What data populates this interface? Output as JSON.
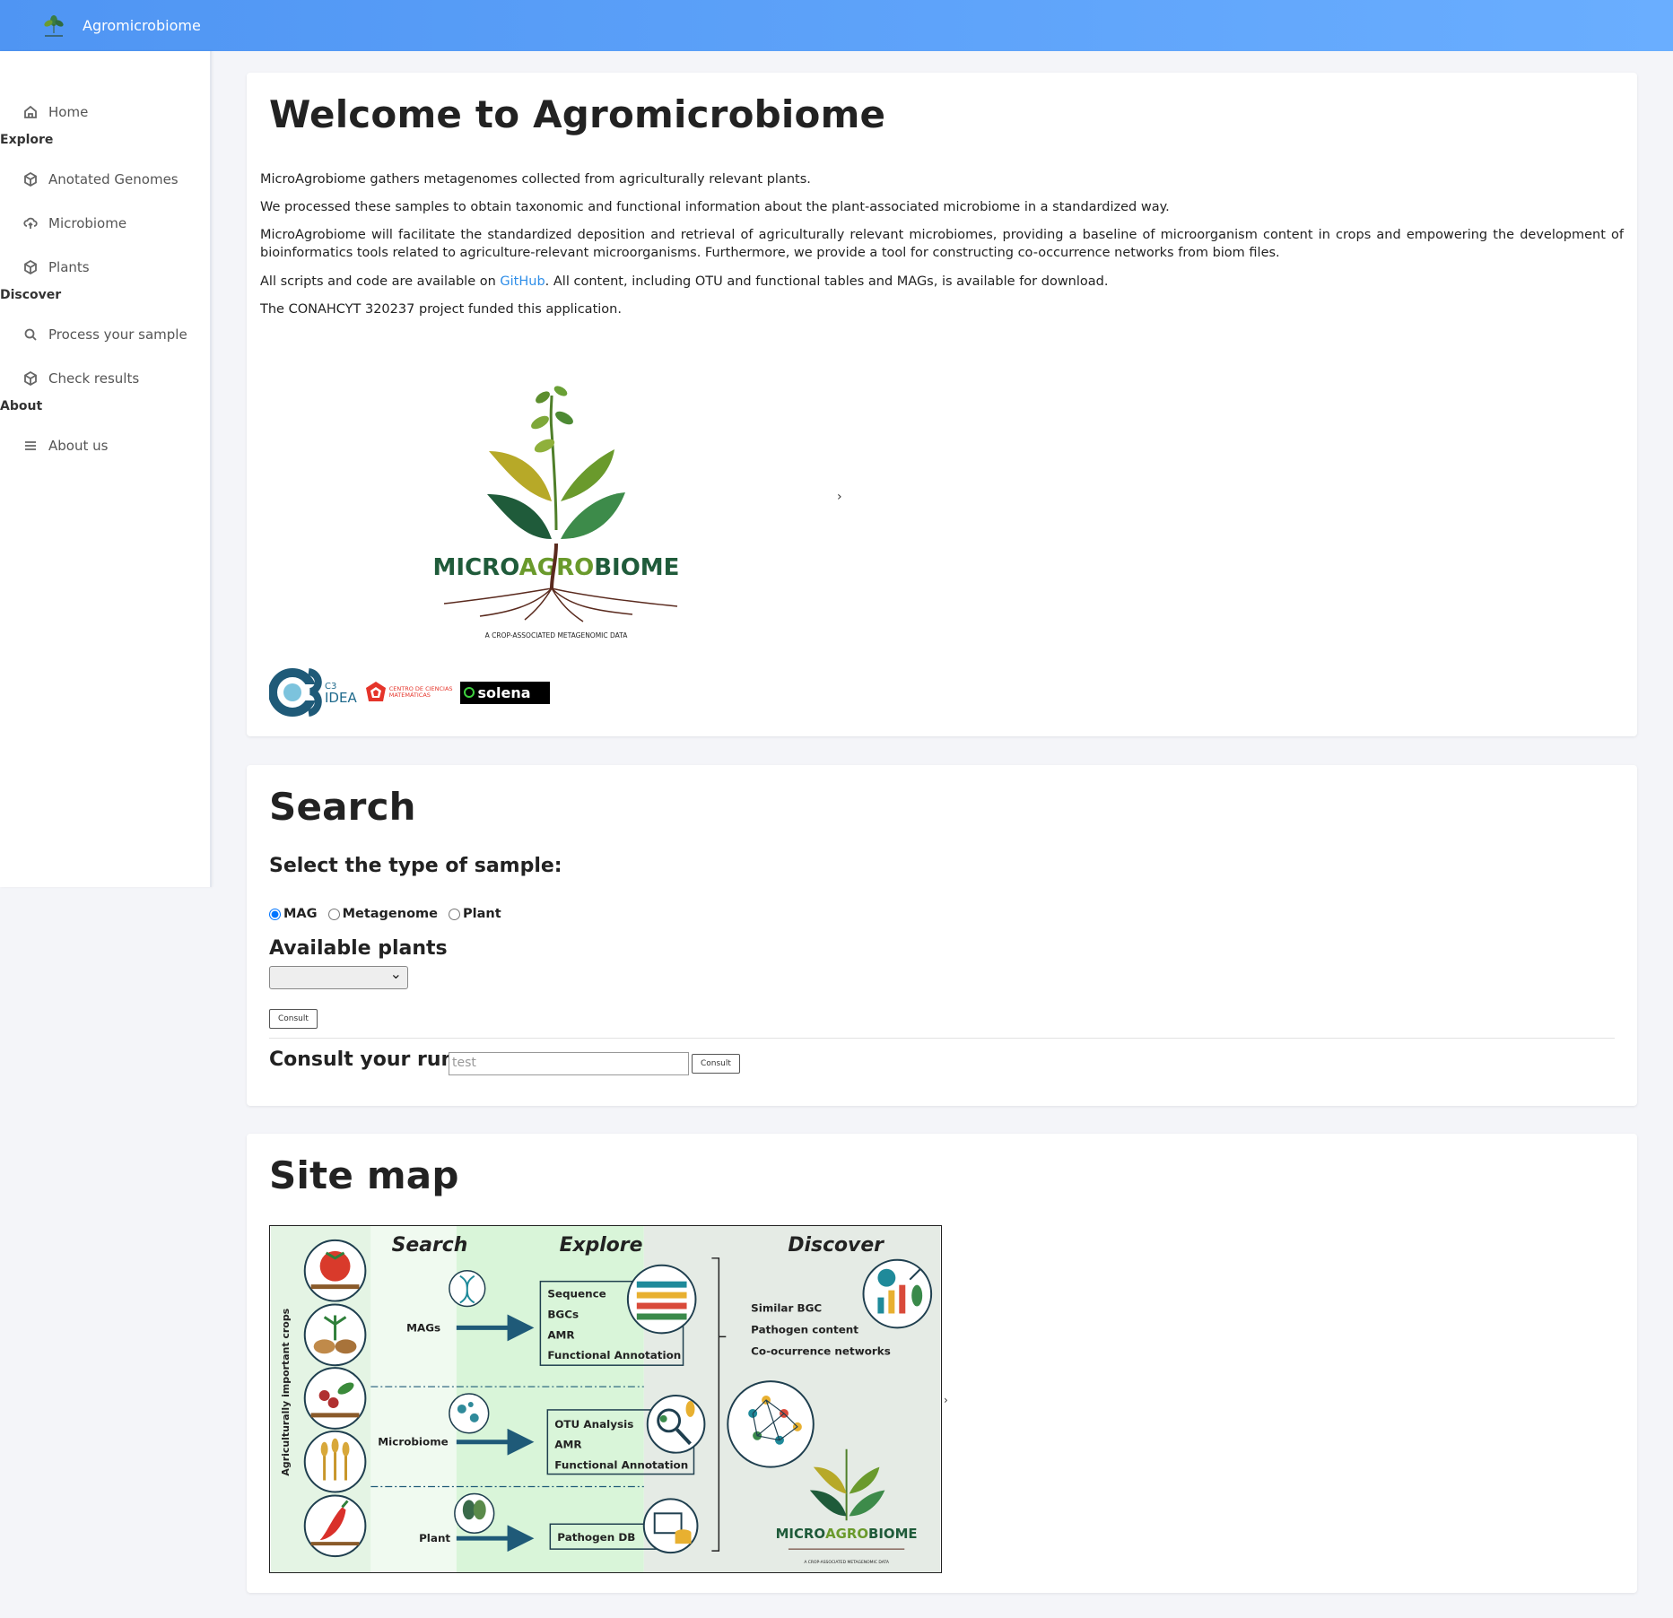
{
  "app": {
    "name": "Agromicrobiome"
  },
  "sidebar": {
    "home": "Home",
    "sections": {
      "explore": "Explore",
      "discover": "Discover",
      "about": "About"
    },
    "explore_items": [
      "Anotated Genomes",
      "Microbiome",
      "Plants"
    ],
    "discover_items": [
      "Process your sample",
      "Check results"
    ],
    "about_items": [
      "About us"
    ]
  },
  "welcome": {
    "title": "Welcome to Agromicrobiome",
    "p1": "MicroAgrobiome gathers metagenomes collected from agriculturally relevant plants.",
    "p2": "We processed these samples to obtain taxonomic and functional information about the plant-associated microbiome in a standardized way.",
    "p3": "MicroAgrobiome will facilitate the standardized deposition and retrieval of agriculturally relevant microbiomes, providing a baseline of microorganism content in crops and empowering the development of bioinformatics tools related to agriculture-relevant microorganisms. Furthermore, we provide a tool for constructing co-occurrence networks from biom files.",
    "p4_before": "All scripts and code are available on ",
    "p4_link": "GitHub",
    "p4_after": ". All content, including OTU and functional tables and MAGs, is available for download.",
    "p5": "The CONAHCYT 320237 project funded this application.",
    "logo_text_micro": "MICRO",
    "logo_text_agro": "AGRO",
    "logo_text_biome": "BIOME",
    "logo_tagline": "A CROP-ASSOCIATED METAGENOMIC DATA",
    "carousel_next": "›",
    "partners": {
      "c3_label": "C3",
      "idea_label": "IDEA",
      "ccm_line1": "CENTRO DE CIENCIAS",
      "ccm_line2": "MATEMÁTICAS",
      "solena": "solena"
    }
  },
  "search": {
    "title": "Search",
    "sample_type_label": "Select the type of sample:",
    "sample_types": [
      "MAG",
      "Metagenome",
      "Plant"
    ],
    "selected_sample_type": "MAG",
    "plants_label": "Available plants",
    "consult_label": "Consult",
    "run_label": "Consult your run",
    "run_value": "test",
    "run_consult_label": "Consult"
  },
  "sitemap": {
    "title": "Site map",
    "col_search": "Search",
    "col_explore": "Explore",
    "col_discover": "Discover",
    "side_label": "Agriculturally important crops",
    "rows": {
      "mags": "MAGs",
      "microbiome": "Microbiome",
      "plant": "Plant"
    },
    "explore_mags": [
      "Sequence",
      "BGCs",
      "AMR",
      "Functional Annotation"
    ],
    "explore_microbiome": [
      "OTU Analysis",
      "AMR",
      "Functional Annotation"
    ],
    "explore_plant": [
      "Pathogen DB"
    ],
    "discover_items": [
      "Similar BGC",
      "Pathogen content",
      "Co-ocurrence networks"
    ],
    "logo_micro": "MICRO",
    "logo_agro": "AGRO",
    "logo_biome": "BIOME",
    "logo_tagline": "A CROP-ASSOCIATED METAGENOMIC DATA",
    "next_arrow": "›"
  },
  "colors": {
    "topbar": "#5aa0f7",
    "link": "#2f8ee8",
    "leaf_dark": "#1f5b3a",
    "leaf_olive": "#b7a928",
    "leaf_green": "#3d8b4a",
    "root": "#5a2a1e"
  }
}
